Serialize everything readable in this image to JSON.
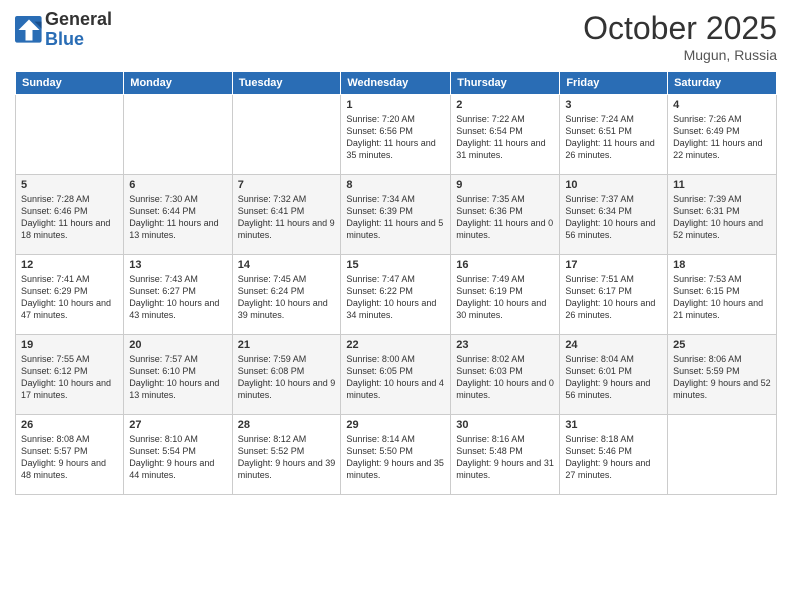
{
  "header": {
    "logo_line1": "General",
    "logo_line2": "Blue",
    "month": "October 2025",
    "location": "Mugun, Russia"
  },
  "days_of_week": [
    "Sunday",
    "Monday",
    "Tuesday",
    "Wednesday",
    "Thursday",
    "Friday",
    "Saturday"
  ],
  "weeks": [
    [
      {
        "day": "",
        "info": ""
      },
      {
        "day": "",
        "info": ""
      },
      {
        "day": "",
        "info": ""
      },
      {
        "day": "1",
        "info": "Sunrise: 7:20 AM\nSunset: 6:56 PM\nDaylight: 11 hours and 35 minutes."
      },
      {
        "day": "2",
        "info": "Sunrise: 7:22 AM\nSunset: 6:54 PM\nDaylight: 11 hours and 31 minutes."
      },
      {
        "day": "3",
        "info": "Sunrise: 7:24 AM\nSunset: 6:51 PM\nDaylight: 11 hours and 26 minutes."
      },
      {
        "day": "4",
        "info": "Sunrise: 7:26 AM\nSunset: 6:49 PM\nDaylight: 11 hours and 22 minutes."
      }
    ],
    [
      {
        "day": "5",
        "info": "Sunrise: 7:28 AM\nSunset: 6:46 PM\nDaylight: 11 hours and 18 minutes."
      },
      {
        "day": "6",
        "info": "Sunrise: 7:30 AM\nSunset: 6:44 PM\nDaylight: 11 hours and 13 minutes."
      },
      {
        "day": "7",
        "info": "Sunrise: 7:32 AM\nSunset: 6:41 PM\nDaylight: 11 hours and 9 minutes."
      },
      {
        "day": "8",
        "info": "Sunrise: 7:34 AM\nSunset: 6:39 PM\nDaylight: 11 hours and 5 minutes."
      },
      {
        "day": "9",
        "info": "Sunrise: 7:35 AM\nSunset: 6:36 PM\nDaylight: 11 hours and 0 minutes."
      },
      {
        "day": "10",
        "info": "Sunrise: 7:37 AM\nSunset: 6:34 PM\nDaylight: 10 hours and 56 minutes."
      },
      {
        "day": "11",
        "info": "Sunrise: 7:39 AM\nSunset: 6:31 PM\nDaylight: 10 hours and 52 minutes."
      }
    ],
    [
      {
        "day": "12",
        "info": "Sunrise: 7:41 AM\nSunset: 6:29 PM\nDaylight: 10 hours and 47 minutes."
      },
      {
        "day": "13",
        "info": "Sunrise: 7:43 AM\nSunset: 6:27 PM\nDaylight: 10 hours and 43 minutes."
      },
      {
        "day": "14",
        "info": "Sunrise: 7:45 AM\nSunset: 6:24 PM\nDaylight: 10 hours and 39 minutes."
      },
      {
        "day": "15",
        "info": "Sunrise: 7:47 AM\nSunset: 6:22 PM\nDaylight: 10 hours and 34 minutes."
      },
      {
        "day": "16",
        "info": "Sunrise: 7:49 AM\nSunset: 6:19 PM\nDaylight: 10 hours and 30 minutes."
      },
      {
        "day": "17",
        "info": "Sunrise: 7:51 AM\nSunset: 6:17 PM\nDaylight: 10 hours and 26 minutes."
      },
      {
        "day": "18",
        "info": "Sunrise: 7:53 AM\nSunset: 6:15 PM\nDaylight: 10 hours and 21 minutes."
      }
    ],
    [
      {
        "day": "19",
        "info": "Sunrise: 7:55 AM\nSunset: 6:12 PM\nDaylight: 10 hours and 17 minutes."
      },
      {
        "day": "20",
        "info": "Sunrise: 7:57 AM\nSunset: 6:10 PM\nDaylight: 10 hours and 13 minutes."
      },
      {
        "day": "21",
        "info": "Sunrise: 7:59 AM\nSunset: 6:08 PM\nDaylight: 10 hours and 9 minutes."
      },
      {
        "day": "22",
        "info": "Sunrise: 8:00 AM\nSunset: 6:05 PM\nDaylight: 10 hours and 4 minutes."
      },
      {
        "day": "23",
        "info": "Sunrise: 8:02 AM\nSunset: 6:03 PM\nDaylight: 10 hours and 0 minutes."
      },
      {
        "day": "24",
        "info": "Sunrise: 8:04 AM\nSunset: 6:01 PM\nDaylight: 9 hours and 56 minutes."
      },
      {
        "day": "25",
        "info": "Sunrise: 8:06 AM\nSunset: 5:59 PM\nDaylight: 9 hours and 52 minutes."
      }
    ],
    [
      {
        "day": "26",
        "info": "Sunrise: 8:08 AM\nSunset: 5:57 PM\nDaylight: 9 hours and 48 minutes."
      },
      {
        "day": "27",
        "info": "Sunrise: 8:10 AM\nSunset: 5:54 PM\nDaylight: 9 hours and 44 minutes."
      },
      {
        "day": "28",
        "info": "Sunrise: 8:12 AM\nSunset: 5:52 PM\nDaylight: 9 hours and 39 minutes."
      },
      {
        "day": "29",
        "info": "Sunrise: 8:14 AM\nSunset: 5:50 PM\nDaylight: 9 hours and 35 minutes."
      },
      {
        "day": "30",
        "info": "Sunrise: 8:16 AM\nSunset: 5:48 PM\nDaylight: 9 hours and 31 minutes."
      },
      {
        "day": "31",
        "info": "Sunrise: 8:18 AM\nSunset: 5:46 PM\nDaylight: 9 hours and 27 minutes."
      },
      {
        "day": "",
        "info": ""
      }
    ]
  ]
}
